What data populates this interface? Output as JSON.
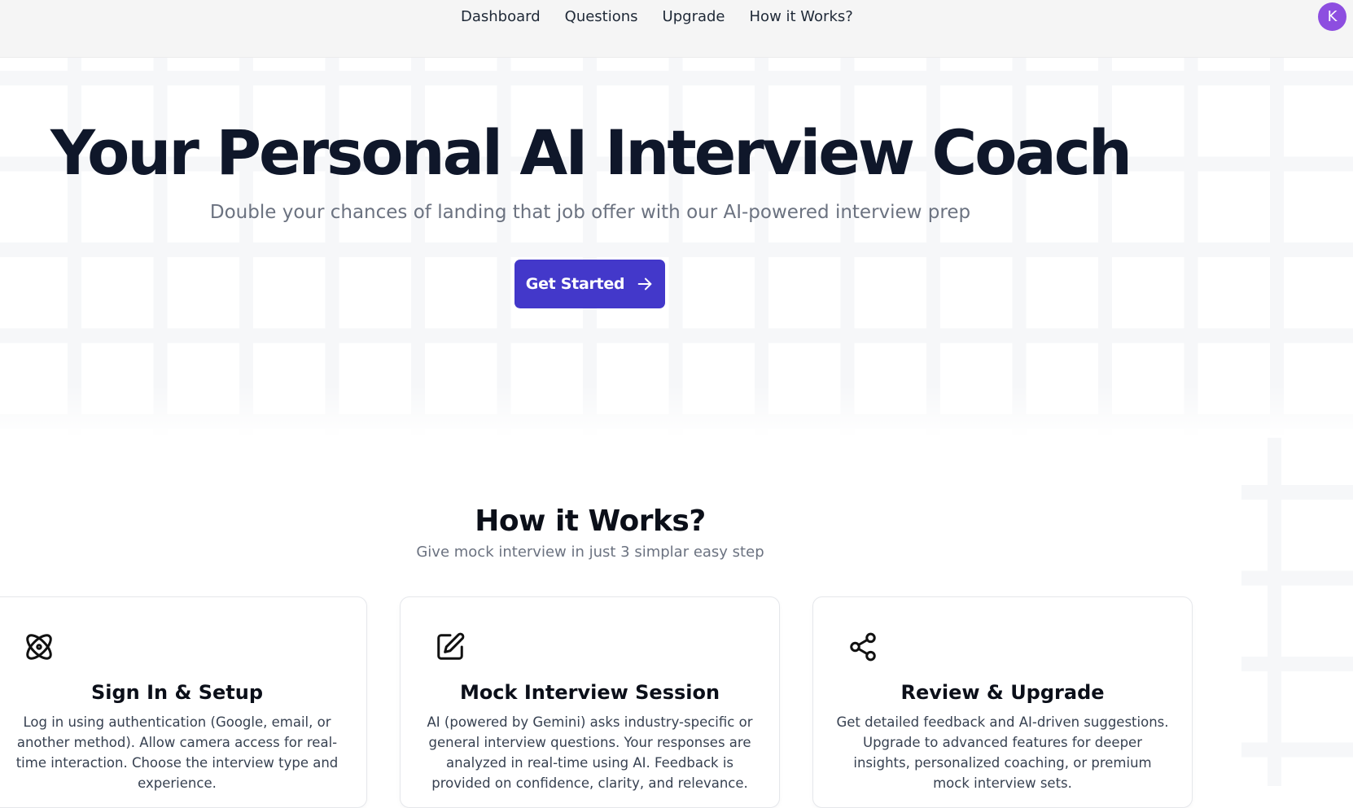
{
  "nav": {
    "items": [
      "Dashboard",
      "Questions",
      "Upgrade",
      "How it Works?"
    ],
    "avatar_initial": "K",
    "avatar_color": "#8d4ee0"
  },
  "hero": {
    "title": "Your Personal AI Interview Coach",
    "subtitle": "Double your chances of landing that job offer with our AI-powered interview prep",
    "cta_label": "Get Started",
    "cta_icon": "arrow-right-icon",
    "cta_color": "#4338ca"
  },
  "how": {
    "title": "How it Works?",
    "subtitle": "Give mock interview in just 3 simplar easy step"
  },
  "cards": [
    {
      "icon": "atom-icon",
      "title": "Sign In & Setup",
      "description": "Log in using authentication (Google, email, or another method). Allow camera access for real-time interaction. Choose the interview type and experience."
    },
    {
      "icon": "edit-square-icon",
      "title": "Mock Interview Session",
      "description": "AI (powered by Gemini) asks industry-specific or general interview questions. Your responses are analyzed in real-time using AI. Feedback is provided on confidence, clarity, and relevance."
    },
    {
      "icon": "share-icon",
      "title": "Review & Upgrade",
      "description": "Get detailed feedback and AI-driven suggestions. Upgrade to advanced features for deeper insights, personalized coaching, or premium mock interview sets."
    }
  ]
}
